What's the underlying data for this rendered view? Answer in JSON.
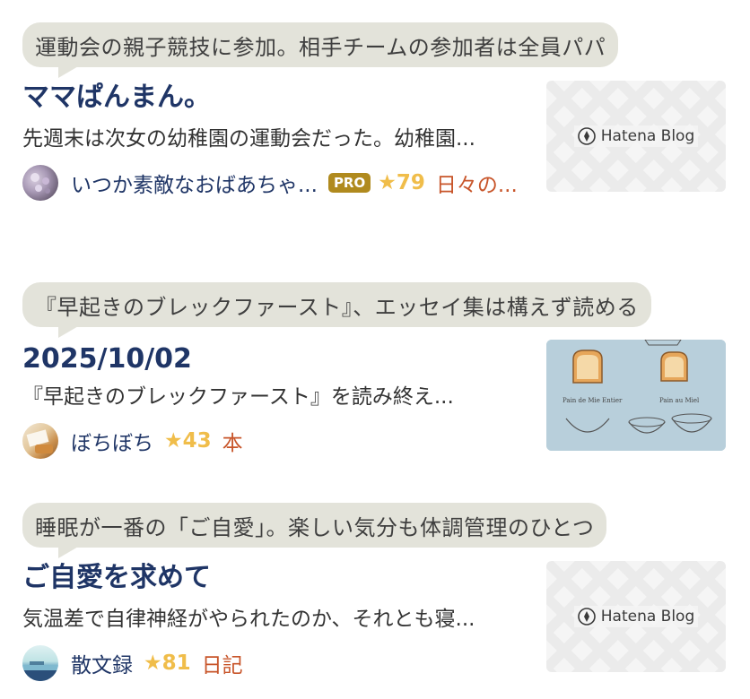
{
  "entries": [
    {
      "comment": "運動会の親子競技に参加。相手チームの参加者は全員パパ",
      "title": "ママぱんまん。",
      "excerpt": "先週末は次女の幼稚園の運動会だった。幼稚園...",
      "author": "いつか素敵なおばあちゃ...",
      "pro": "PRO",
      "stars": "★79",
      "category": "日々の...",
      "thumbnail": "hatena",
      "thumbnail_label": "Hatena Blog"
    },
    {
      "comment": "『早起きのブレックファースト』、エッセイ集は構えず読める",
      "title": "2025/10/02",
      "excerpt": "『早起きのブレックファースト』を読み終え...",
      "author": "ぼちぼち",
      "stars": "★43",
      "category": "本",
      "thumbnail": "toast-illustration",
      "thumbnail_captions": [
        "Pain de Mie Entier",
        "Pain au Miel"
      ]
    },
    {
      "comment": "睡眠が一番の「ご自愛」。楽しい気分も体調管理のひとつ",
      "title": "ご自愛を求めて",
      "excerpt": "気温差で自律神経がやられたのか、それとも寝...",
      "author": "散文録",
      "stars": "★81",
      "category": "日記",
      "thumbnail": "hatena",
      "thumbnail_label": "Hatena Blog"
    }
  ],
  "colors": {
    "bubble": "#e3e3da",
    "title": "#1f3566",
    "author": "#1f3566",
    "star": "#f0bd4a",
    "category": "#c8552a",
    "pro_badge": "#b08a1e"
  }
}
